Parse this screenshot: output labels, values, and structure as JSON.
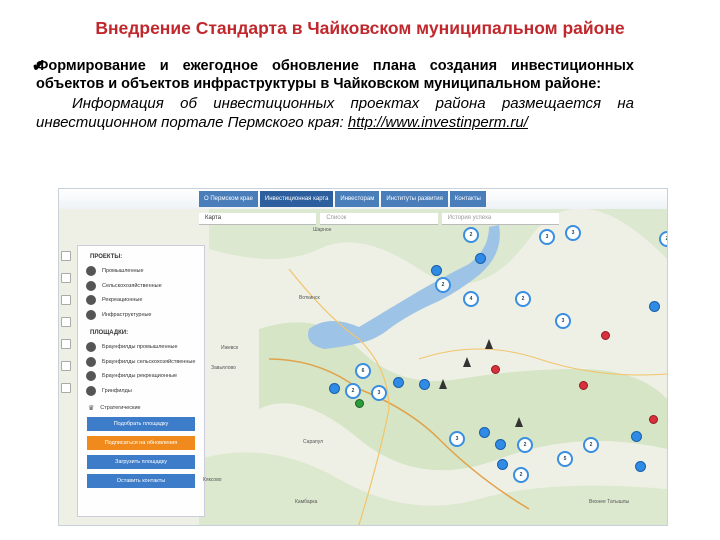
{
  "title": "Внедрение Стандарта в Чайковском муниципальном районе",
  "bullet_bold": "Формирование и ежегодное обновление плана создания инвестиционных объектов и объектов инфраструктуры в Чайковском муниципальном районе:",
  "bullet_italic": "Информация об инвестиционных проектах района размещается на инвестиционном портале Пермского края:",
  "portal_link": "http://www.investinperm.ru/",
  "portal": {
    "nav_tabs": [
      "О Пермском крае",
      "Инвестиционная карта",
      "Инвесторам",
      "Институты развития",
      "Контакты"
    ],
    "active_tab": "Инвестиционная карта",
    "sub_tabs": [
      "Карта",
      "Список",
      "История успеха"
    ],
    "legend": {
      "projects_header": "ПРОЕКТЫ:",
      "projects": [
        "Промышленные",
        "Сельскохозяйственные",
        "Рекреационные",
        "Инфраструктурные"
      ],
      "sites_header": "ПЛОЩАДКИ:",
      "sites": [
        "Браунфилды промышленные",
        "Браунфилды сельскохозяйственные",
        "Браунфилды рекреационные",
        "Гринфилды"
      ],
      "strategic": "Стратегические"
    },
    "buttons": [
      "Подобрать площадку",
      "Подписаться на обновления",
      "Загрузить площадку",
      "Оставить контакты"
    ],
    "places": [
      "Шарнон",
      "Воткинск",
      "Ижевск",
      "Завьялово",
      "Сарапул",
      "Камбарка",
      "Кяксово",
      "Вехнее Татышлы"
    ],
    "marker_numbers": [
      "2",
      "3",
      "3",
      "2",
      "2",
      "4",
      "2",
      "3",
      "6",
      "2",
      "3",
      "3",
      "2",
      "5",
      "2",
      "2"
    ],
    "colors": {
      "nav": "#4a7ebb",
      "button": "#3d7cc9",
      "button_alt": "#f08a1c",
      "title": "#c0282d"
    }
  }
}
